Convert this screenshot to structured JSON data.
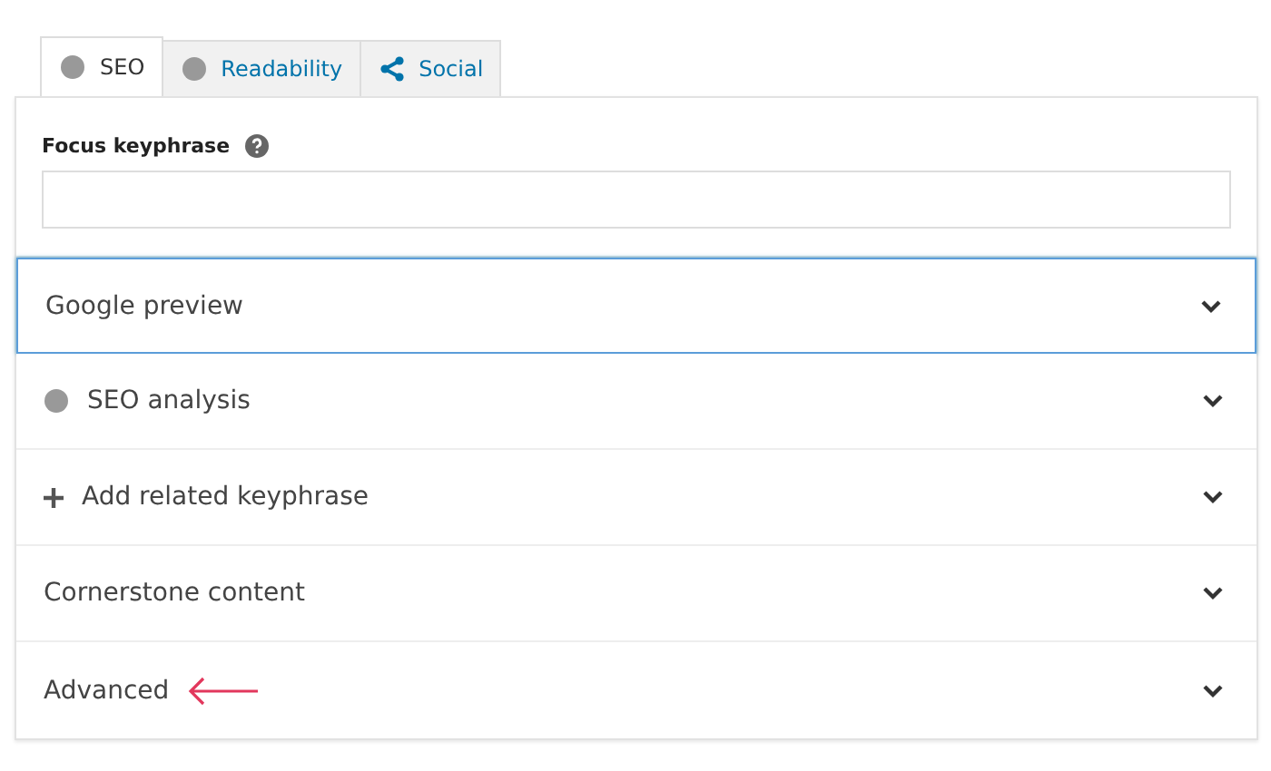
{
  "tabs": [
    {
      "label": "SEO",
      "kind": "dot",
      "selected": true
    },
    {
      "label": "Readability",
      "kind": "dot",
      "selected": false
    },
    {
      "label": "Social",
      "kind": "share",
      "selected": false
    }
  ],
  "focus_keyphrase": {
    "label": "Focus keyphrase"
  },
  "sections": [
    {
      "label": "Google preview",
      "kind": "plain",
      "focused": true,
      "pointed": false
    },
    {
      "label": "SEO analysis",
      "kind": "dot",
      "focused": false,
      "pointed": false
    },
    {
      "label": "Add related keyphrase",
      "kind": "plus",
      "focused": false,
      "pointed": false
    },
    {
      "label": "Cornerstone content",
      "kind": "plain",
      "focused": false,
      "pointed": false
    },
    {
      "label": "Advanced",
      "kind": "plain",
      "focused": false,
      "pointed": true
    }
  ]
}
